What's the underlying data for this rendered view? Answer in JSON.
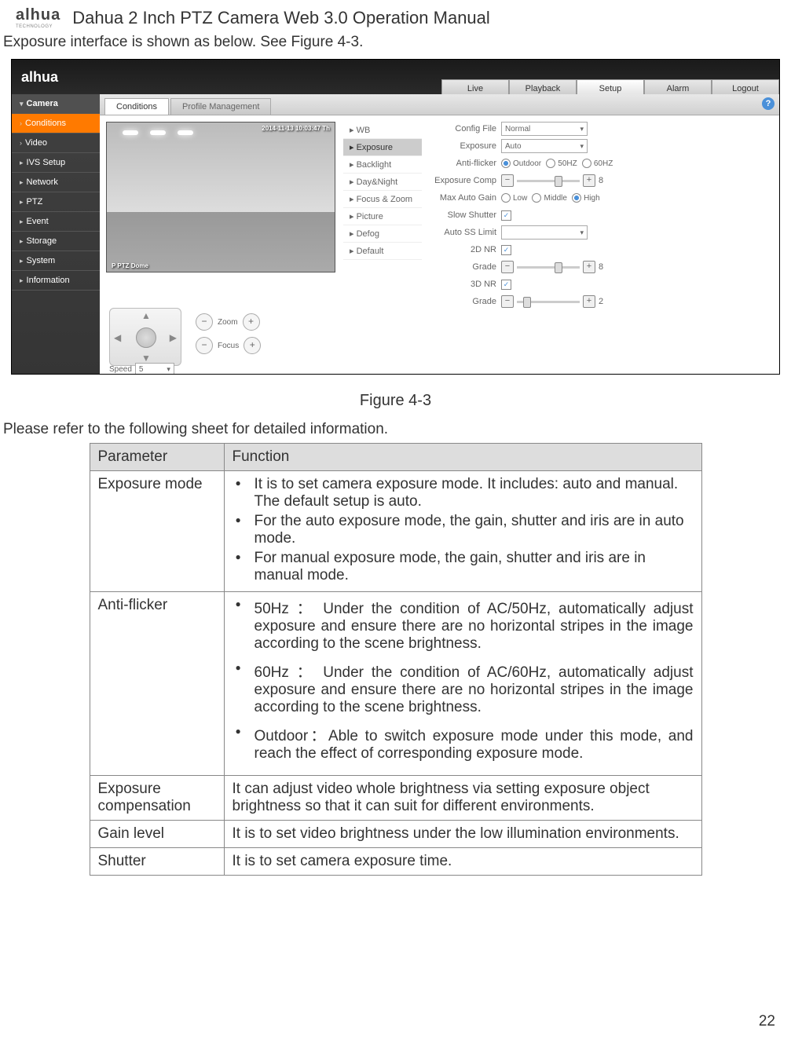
{
  "header": {
    "brand": "alhua",
    "brandSub": "TECHNOLOGY",
    "docTitle": "Dahua 2 Inch PTZ Camera Web 3.0 Operation Manual"
  },
  "intro": "Exposure interface is shown as below. See Figure 4-3.",
  "screenshot": {
    "logo": "alhua",
    "nav": [
      "Live",
      "Playback",
      "Setup",
      "Alarm",
      "Logout"
    ],
    "navActiveIndex": 2,
    "sidebar": {
      "header": "Camera",
      "items": [
        "Conditions",
        "Video",
        "IVS Setup",
        "Network",
        "PTZ",
        "Event",
        "Storage",
        "System",
        "Information"
      ],
      "activeIndex": 0
    },
    "tabs": [
      "Conditions",
      "Profile Management"
    ],
    "tabActiveIndex": 0,
    "preview": {
      "timestamp": "2014-11-13 10:03:47 Th",
      "label": "P PTZ Dome"
    },
    "subMenu": [
      "WB",
      "Exposure",
      "Backlight",
      "Day&Night",
      "Focus & Zoom",
      "Picture",
      "Defog",
      "Default"
    ],
    "subActiveIndex": 1,
    "params": {
      "configFile": {
        "label": "Config File",
        "value": "Normal"
      },
      "exposure": {
        "label": "Exposure",
        "value": "Auto"
      },
      "antiFlicker": {
        "label": "Anti-flicker",
        "options": [
          "Outdoor",
          "50HZ",
          "60HZ"
        ],
        "selected": 0
      },
      "expComp": {
        "label": "Exposure Comp",
        "value": "8"
      },
      "maxGain": {
        "label": "Max Auto Gain",
        "options": [
          "Low",
          "Middle",
          "High"
        ],
        "selected": 2
      },
      "slowShutter": {
        "label": "Slow Shutter",
        "checked": true
      },
      "autoSS": {
        "label": "Auto SS Limit",
        "value": ""
      },
      "nr2d": {
        "label": "2D NR",
        "checked": true
      },
      "grade1": {
        "label": "Grade",
        "value": "8"
      },
      "nr3d": {
        "label": "3D NR",
        "checked": true
      },
      "grade2": {
        "label": "Grade",
        "value": "2"
      }
    },
    "ptz": {
      "zoom": "Zoom",
      "focus": "Focus",
      "speedLabel": "Speed",
      "speedValue": "5"
    }
  },
  "figCaption": "Figure 4-3",
  "tableLead": "Please refer to the following sheet for detailed information.",
  "tableHead": {
    "c1": "Parameter",
    "c2": "Function"
  },
  "rows": {
    "expMode": {
      "param": "Exposure mode",
      "b1": "It is to set camera exposure mode. It includes: auto and manual. The default setup is auto.",
      "b2": "For the auto exposure mode, the gain, shutter and iris are in auto mode.",
      "b3": "For manual exposure mode, the gain, shutter and iris are in manual mode."
    },
    "antiFlicker": {
      "param": "Anti-flicker",
      "b1": "50Hz ： Under the condition of AC/50Hz, automatically adjust exposure and ensure there are no horizontal stripes in the image according to the scene brightness.",
      "b2": "60Hz ： Under the condition of AC/60Hz, automatically adjust exposure and ensure there are no horizontal stripes in the image according to the scene brightness.",
      "b3": "Outdoor：Able to switch exposure mode under this mode, and reach the effect of corresponding exposure mode."
    },
    "expComp": {
      "param": "Exposure compensation",
      "func": "It can adjust video whole brightness via setting exposure object brightness so that it can suit for different environments."
    },
    "gain": {
      "param": "Gain level",
      "func": "It is to set video brightness under the low illumination environments."
    },
    "shutter": {
      "param": "Shutter",
      "func": "It is to set camera exposure time."
    }
  },
  "pageNum": "22"
}
